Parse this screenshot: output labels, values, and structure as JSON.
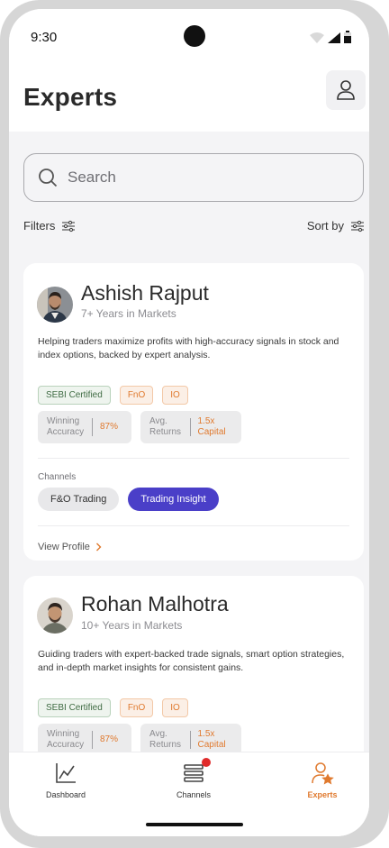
{
  "status": {
    "time": "9:30"
  },
  "header": {
    "title": "Experts"
  },
  "search": {
    "placeholder": "Search"
  },
  "toolbar": {
    "filters_label": "Filters",
    "sort_label": "Sort by"
  },
  "experts": [
    {
      "name": "Ashish Rajput",
      "years": "7+ Years in Markets",
      "description": "Helping traders maximize profits with high-accuracy signals in stock and index options, backed by expert analysis.",
      "tags": [
        "SEBI Certified",
        "FnO",
        "IO"
      ],
      "stats": [
        {
          "label": "Winning Accuracy",
          "value": "87%"
        },
        {
          "label": "Avg. Returns",
          "value": "1.5x Capital"
        }
      ],
      "channels_label": "Channels",
      "channels": [
        "F&O Trading",
        "Trading Insight"
      ],
      "view_profile": "View Profile"
    },
    {
      "name": "Rohan Malhotra",
      "years": "10+ Years in Markets",
      "description": "Guiding traders with expert-backed trade signals, smart option strategies, and in-depth market insights for consistent gains.",
      "tags": [
        "SEBI Certified",
        "FnO",
        "IO"
      ],
      "stats": [
        {
          "label": "Winning Accuracy",
          "value": "87%"
        },
        {
          "label": "Avg. Returns",
          "value": "1.5x Capital"
        }
      ]
    }
  ],
  "nav": {
    "dashboard": "Dashboard",
    "channels": "Channels",
    "experts": "Experts"
  },
  "colors": {
    "accent": "#e07a2f",
    "primary": "#4a3fc8",
    "notification": "#e02b2b"
  }
}
